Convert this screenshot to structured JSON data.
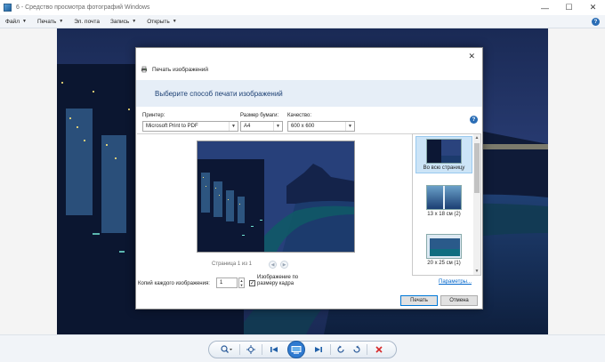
{
  "window": {
    "title": "6 - Средство просмотра фотографий Windows",
    "minimize_glyph": "—",
    "maximize_glyph": "☐",
    "close_glyph": "✕"
  },
  "menu": {
    "items": [
      {
        "label": "Файл"
      },
      {
        "label": "Печать"
      },
      {
        "label": "Эл. почта"
      },
      {
        "label": "Запись"
      },
      {
        "label": "Открыть"
      }
    ],
    "help": "?"
  },
  "dialog": {
    "title": "Печать изображений",
    "header": "Выберите способ печати изображений",
    "close_glyph": "✕",
    "help": "?",
    "printer": {
      "label": "Принтер:",
      "value": "Microsoft Print to PDF"
    },
    "paper_size": {
      "label": "Размер бумаги:",
      "value": "A4"
    },
    "quality": {
      "label": "Качество:",
      "value": "600 x 600"
    },
    "page_indicator": "Страница 1 из 1",
    "layouts": [
      {
        "label": "Во всю страницу",
        "selected": true
      },
      {
        "label": "13 x 18 см (2)",
        "selected": false
      },
      {
        "label": "20 x 25 см (1)",
        "selected": false
      }
    ],
    "copies": {
      "label": "Копий каждого изображения:",
      "value": "1"
    },
    "fit_to_frame": {
      "label": "Изображение по размеру кадра",
      "checked": true,
      "check_glyph": "✓"
    },
    "params_link": "Параметры...",
    "print_button": "Печать",
    "cancel_button": "Отмена"
  },
  "icons": {
    "app": "photo-viewer-icon",
    "zoom": "zoom-icon",
    "actual_size": "actual-size-icon",
    "previous": "previous-icon",
    "slideshow": "slideshow-icon",
    "next": "next-icon",
    "rotate_left": "rotate-left-icon",
    "rotate_right": "rotate-right-icon",
    "delete": "delete-icon"
  },
  "colors": {
    "accent": "#0078d7",
    "delete_red": "#d62828",
    "header_text": "#1b3f73",
    "link": "#0066cc"
  }
}
